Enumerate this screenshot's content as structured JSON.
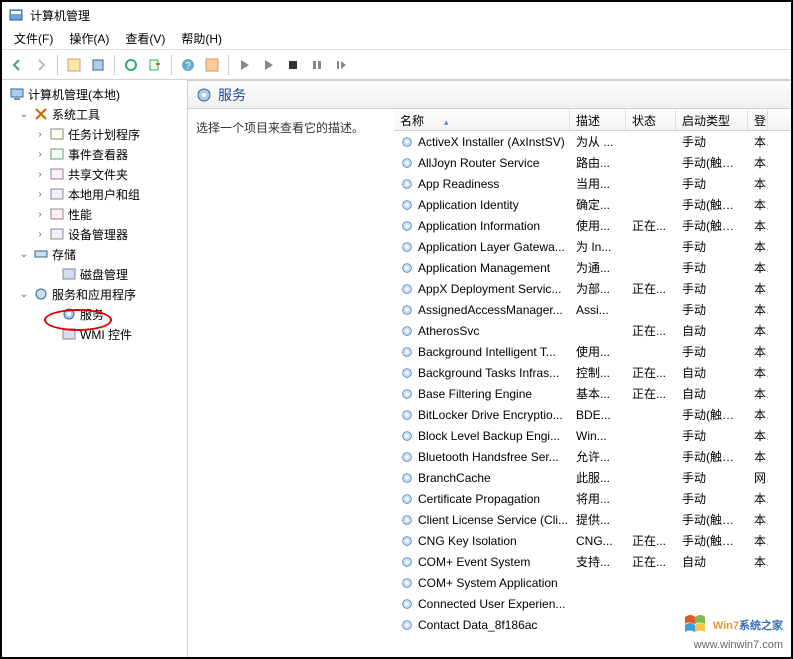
{
  "title": "计算机管理",
  "menus": [
    "文件(F)",
    "操作(A)",
    "查看(V)",
    "帮助(H)"
  ],
  "tree": {
    "root": "计算机管理(本地)",
    "sys_tools": "系统工具",
    "sys_children": [
      "任务计划程序",
      "事件查看器",
      "共享文件夹",
      "本地用户和组",
      "性能",
      "设备管理器"
    ],
    "storage": "存储",
    "storage_children": [
      "磁盘管理"
    ],
    "services_apps": "服务和应用程序",
    "sa_children": [
      "服务",
      "WMI 控件"
    ]
  },
  "svc_title": "服务",
  "desc_hint": "选择一个项目来查看它的描述。",
  "columns": [
    "名称",
    "描述",
    "状态",
    "启动类型",
    "登"
  ],
  "services": [
    {
      "name": "ActiveX Installer (AxInstSV)",
      "desc": "为从 ...",
      "stat": "",
      "start": "手动",
      "log": "本"
    },
    {
      "name": "AllJoyn Router Service",
      "desc": "路由...",
      "stat": "",
      "start": "手动(触发...",
      "log": "本"
    },
    {
      "name": "App Readiness",
      "desc": "当用...",
      "stat": "",
      "start": "手动",
      "log": "本"
    },
    {
      "name": "Application Identity",
      "desc": "确定...",
      "stat": "",
      "start": "手动(触发...",
      "log": "本"
    },
    {
      "name": "Application Information",
      "desc": "使用...",
      "stat": "正在...",
      "start": "手动(触发...",
      "log": "本"
    },
    {
      "name": "Application Layer Gatewa...",
      "desc": "为 In...",
      "stat": "",
      "start": "手动",
      "log": "本"
    },
    {
      "name": "Application Management",
      "desc": "为通...",
      "stat": "",
      "start": "手动",
      "log": "本"
    },
    {
      "name": "AppX Deployment Servic...",
      "desc": "为部...",
      "stat": "正在...",
      "start": "手动",
      "log": "本"
    },
    {
      "name": "AssignedAccessManager...",
      "desc": "Assi...",
      "stat": "",
      "start": "手动",
      "log": "本"
    },
    {
      "name": "AtherosSvc",
      "desc": "",
      "stat": "正在...",
      "start": "自动",
      "log": "本"
    },
    {
      "name": "Background Intelligent T...",
      "desc": "使用...",
      "stat": "",
      "start": "手动",
      "log": "本"
    },
    {
      "name": "Background Tasks Infras...",
      "desc": "控制...",
      "stat": "正在...",
      "start": "自动",
      "log": "本"
    },
    {
      "name": "Base Filtering Engine",
      "desc": "基本...",
      "stat": "正在...",
      "start": "自动",
      "log": "本"
    },
    {
      "name": "BitLocker Drive Encryptio...",
      "desc": "BDE...",
      "stat": "",
      "start": "手动(触发...",
      "log": "本"
    },
    {
      "name": "Block Level Backup Engi...",
      "desc": "Win...",
      "stat": "",
      "start": "手动",
      "log": "本"
    },
    {
      "name": "Bluetooth Handsfree Ser...",
      "desc": "允许...",
      "stat": "",
      "start": "手动(触发...",
      "log": "本"
    },
    {
      "name": "BranchCache",
      "desc": "此服...",
      "stat": "",
      "start": "手动",
      "log": "网"
    },
    {
      "name": "Certificate Propagation",
      "desc": "将用...",
      "stat": "",
      "start": "手动",
      "log": "本"
    },
    {
      "name": "Client License Service (Cli...",
      "desc": "提供...",
      "stat": "",
      "start": "手动(触发...",
      "log": "本"
    },
    {
      "name": "CNG Key Isolation",
      "desc": "CNG...",
      "stat": "正在...",
      "start": "手动(触发...",
      "log": "本"
    },
    {
      "name": "COM+ Event System",
      "desc": "支持...",
      "stat": "正在...",
      "start": "自动",
      "log": "本"
    },
    {
      "name": "COM+ System Application",
      "desc": "",
      "stat": "",
      "start": "",
      "log": ""
    },
    {
      "name": "Connected User Experien...",
      "desc": "",
      "stat": "",
      "start": "",
      "log": ""
    },
    {
      "name": "Contact Data_8f186ac",
      "desc": "",
      "stat": "",
      "start": "",
      "log": ""
    }
  ],
  "watermark": {
    "brand": "Win7系统之家",
    "url": "www.winwin7.com"
  }
}
